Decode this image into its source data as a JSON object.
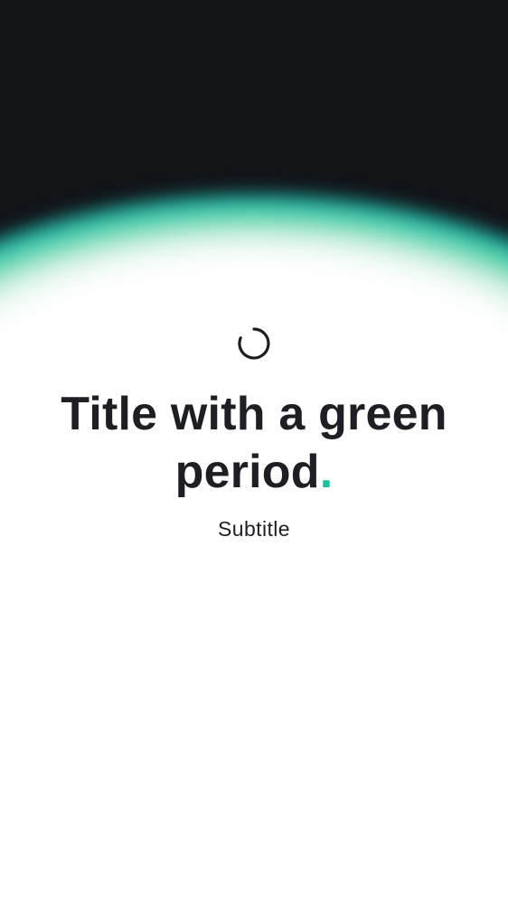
{
  "hero": {
    "title_text": "Title with a green period",
    "title_period": ".",
    "subtitle": "Subtitle"
  },
  "colors": {
    "background_dark": "#121418",
    "text": "#1e1f24",
    "accent_green": "#18c29c",
    "glow_blue": "#0a70a9",
    "glow_teal": "#13a9a3"
  },
  "icons": {
    "loading": "loading-spinner-icon"
  }
}
